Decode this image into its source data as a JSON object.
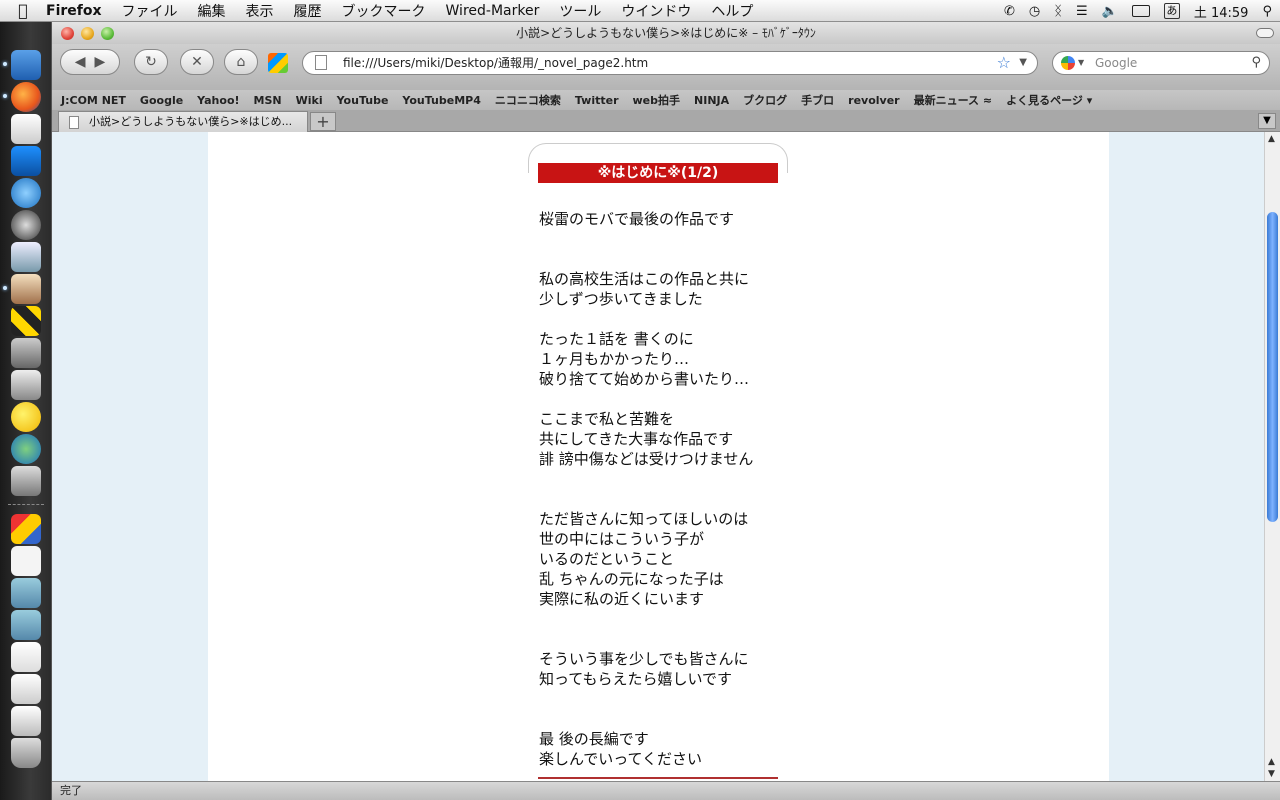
{
  "menubar": {
    "app": "Firefox",
    "items": [
      "ファイル",
      "編集",
      "表示",
      "履歴",
      "ブックマーク",
      "Wired-Marker",
      "ツール",
      "ウインドウ",
      "ヘルプ"
    ],
    "ime": "あ",
    "clock": "土 14:59"
  },
  "window": {
    "title": "小説>どうしようもない僕ら>※はじめに※ – ﾓﾊﾞｹﾞｰﾀｳﾝ"
  },
  "toolbar": {
    "url": "file:///Users/miki/Desktop/通報用/_novel_page2.htm",
    "search_placeholder": "Google"
  },
  "bookmarks": [
    "J:COM NET",
    "Google",
    "Yahoo!",
    "MSN",
    "Wiki",
    "YouTube",
    "YouTubeMP4",
    "ニコニコ検索",
    "Twitter",
    "web拍手",
    "NINJA",
    "ブクログ",
    "手ブロ",
    "revolver",
    "最新ニュース",
    "よく見るページ"
  ],
  "tab": {
    "label": "小説>どうしようもない僕ら>※はじめ...",
    "new_tab": "+"
  },
  "page": {
    "heading": "※はじめに※(1/2)",
    "paragraphs": [
      "桜雷のモバで最後の作品です",
      "",
      "",
      "私の高校生活はこの作品と共に",
      "少しずつ歩いてきました",
      "",
      "たった１話を 書くのに",
      "１ヶ月もかかったり…",
      "破り捨てて始めから書いたり…",
      "",
      "ここまで私と苦難を",
      "共にしてきた大事な作品です",
      "誹 謗中傷などは受けつけません",
      "",
      "",
      "ただ皆さんに知ってほしいのは",
      "世の中にはこういう子が",
      "いるのだということ",
      "乱 ちゃんの元になった子は",
      "実際に私の近くにいます",
      "",
      "",
      "そういう事を少しでも皆さんに",
      "知ってもらえたら嬉しいです",
      "",
      "",
      "最 後の長編です",
      "楽しんでいってください"
    ]
  },
  "status": "完了",
  "colors": {
    "heading_bg": "#c81414",
    "page_bg": "#e5f0f7"
  }
}
